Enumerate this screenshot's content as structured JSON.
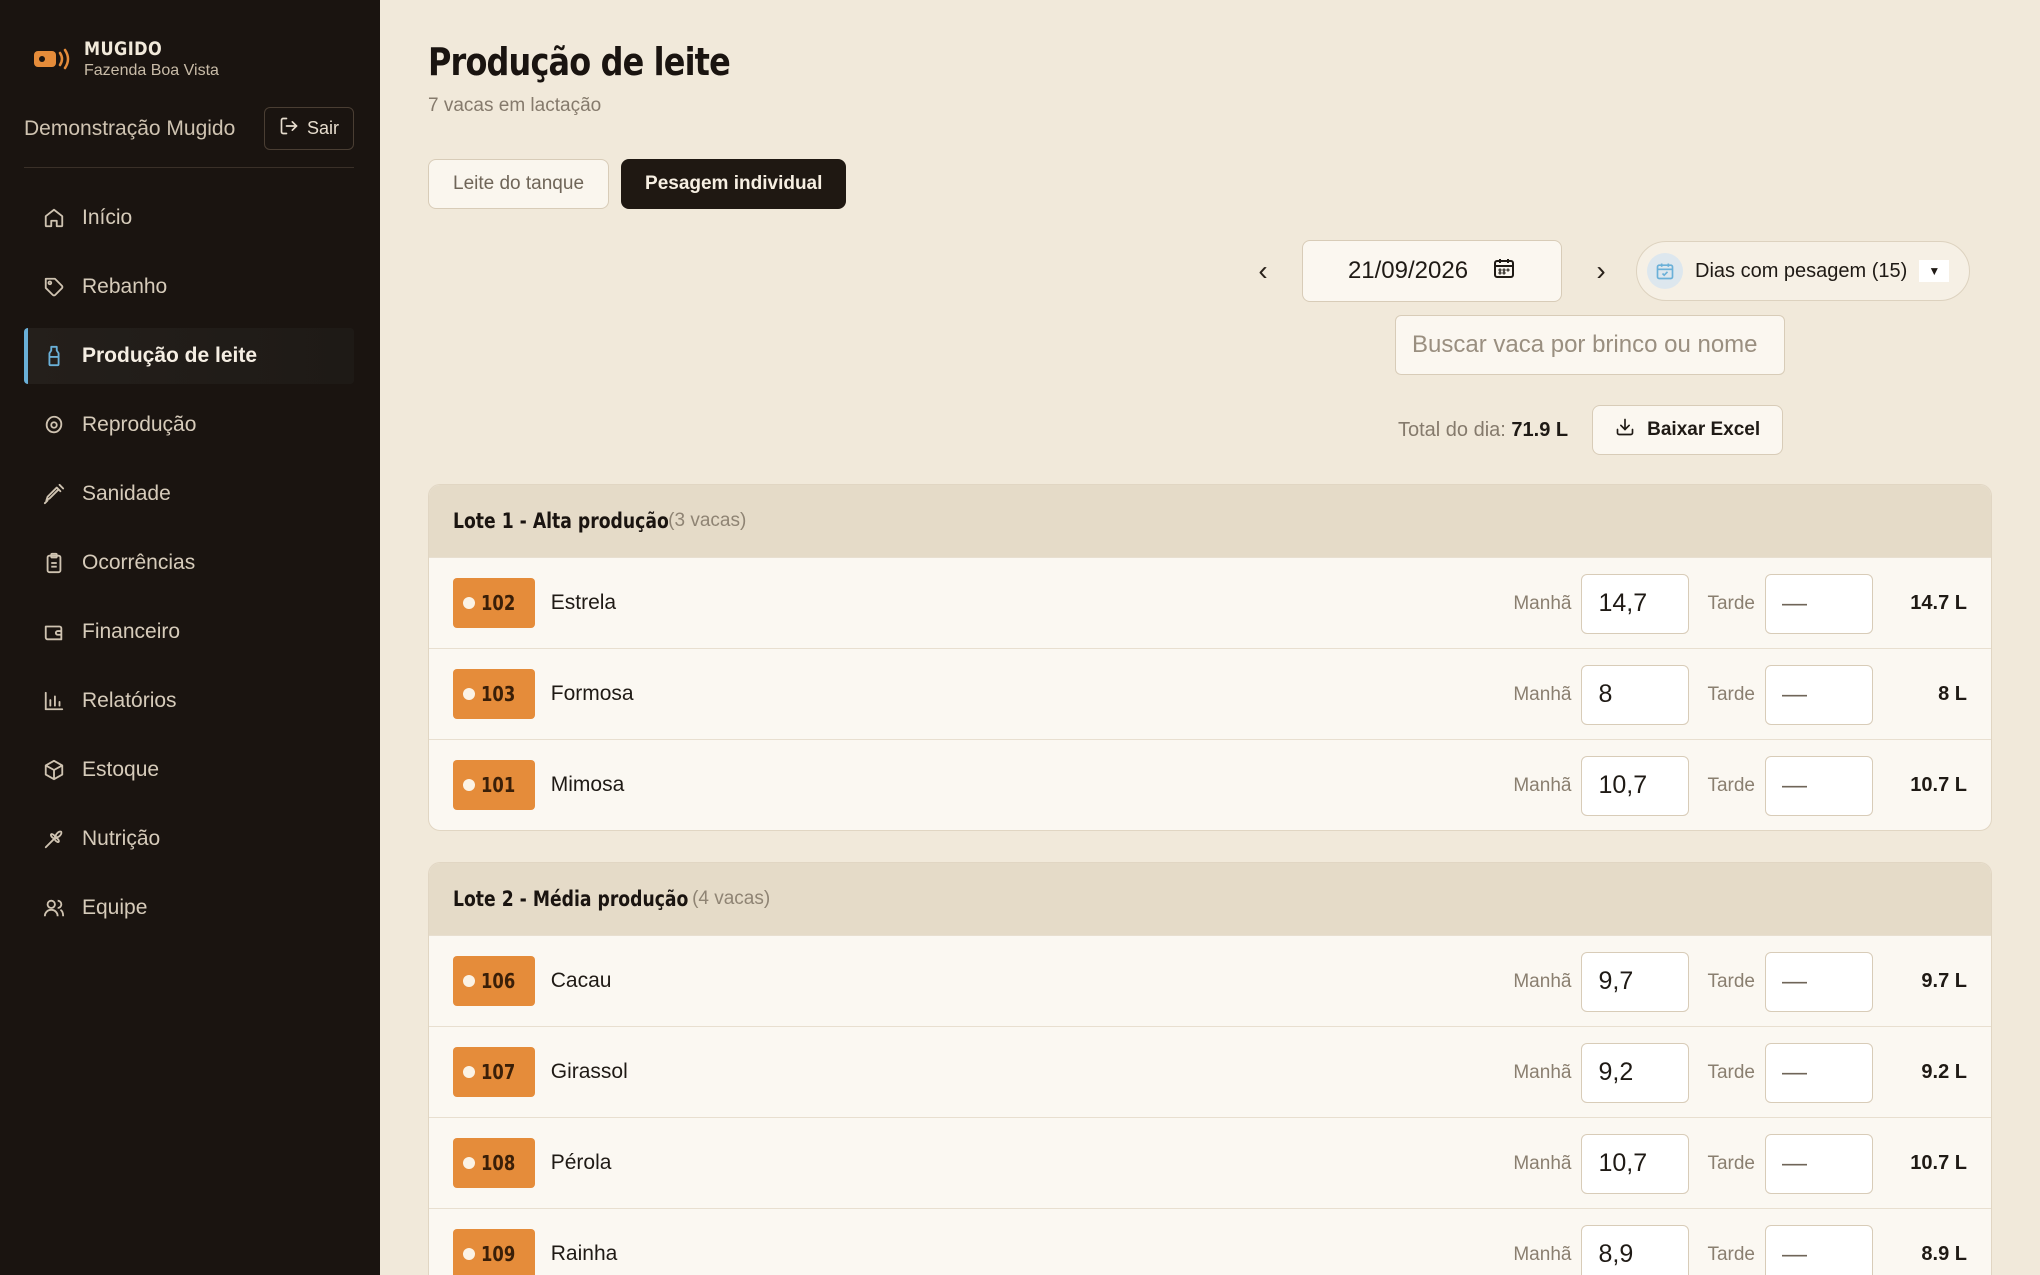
{
  "brand": {
    "name": "MUGIDO",
    "farm": "Fazenda Boa Vista"
  },
  "user": {
    "name": "Demonstração Mugido",
    "logout_label": "Sair"
  },
  "nav": [
    {
      "label": "Início",
      "icon": "home-icon"
    },
    {
      "label": "Rebanho",
      "icon": "tag-icon"
    },
    {
      "label": "Produção de leite",
      "icon": "milk-bottle-icon",
      "active": true
    },
    {
      "label": "Reprodução",
      "icon": "reproduction-icon"
    },
    {
      "label": "Sanidade",
      "icon": "syringe-icon"
    },
    {
      "label": "Ocorrências",
      "icon": "clipboard-icon"
    },
    {
      "label": "Financeiro",
      "icon": "wallet-icon"
    },
    {
      "label": "Relatórios",
      "icon": "bar-chart-icon"
    },
    {
      "label": "Estoque",
      "icon": "box-icon"
    },
    {
      "label": "Nutrição",
      "icon": "wheat-icon"
    },
    {
      "label": "Equipe",
      "icon": "users-icon"
    }
  ],
  "page": {
    "title": "Produção de leite",
    "subtitle": "7 vacas em lactação"
  },
  "tabs": [
    {
      "label": "Leite do tanque",
      "active": false
    },
    {
      "label": "Pesagem individual",
      "active": true
    }
  ],
  "date_nav": {
    "prev": "‹",
    "date": "21/09/2026",
    "next": "›",
    "days_label": "Dias com pesagem (15)"
  },
  "search": {
    "placeholder": "Buscar vaca por brinco ou nome",
    "value": ""
  },
  "summary": {
    "total_label": "Total do dia:",
    "total_value": "71.9 L",
    "excel_label": "Baixar Excel"
  },
  "labels": {
    "morning": "Manhã",
    "afternoon": "Tarde",
    "empty": "—"
  },
  "groups": [
    {
      "title": "Lote 1 - Alta produção",
      "count": "(3 vacas)",
      "cows": [
        {
          "tag": "102",
          "name": "Estrela",
          "morning": "14,7",
          "afternoon": "",
          "total": "14.7 L"
        },
        {
          "tag": "103",
          "name": "Formosa",
          "morning": "8",
          "afternoon": "",
          "total": "8 L"
        },
        {
          "tag": "101",
          "name": "Mimosa",
          "morning": "10,7",
          "afternoon": "",
          "total": "10.7 L"
        }
      ]
    },
    {
      "title": "Lote 2 - Média produção",
      "count": "(4 vacas)",
      "cows": [
        {
          "tag": "106",
          "name": "Cacau",
          "morning": "9,7",
          "afternoon": "",
          "total": "9.7 L"
        },
        {
          "tag": "107",
          "name": "Girassol",
          "morning": "9,2",
          "afternoon": "",
          "total": "9.2 L"
        },
        {
          "tag": "108",
          "name": "Pérola",
          "morning": "10,7",
          "afternoon": "",
          "total": "10.7 L"
        },
        {
          "tag": "109",
          "name": "Rainha",
          "morning": "8,9",
          "afternoon": "",
          "total": "8.9 L"
        }
      ]
    }
  ],
  "colors": {
    "accent": "#e58c3a",
    "sidebar_bg": "#1a1410",
    "page_bg": "#f1e9da",
    "active_marker": "#6ab0d8"
  }
}
